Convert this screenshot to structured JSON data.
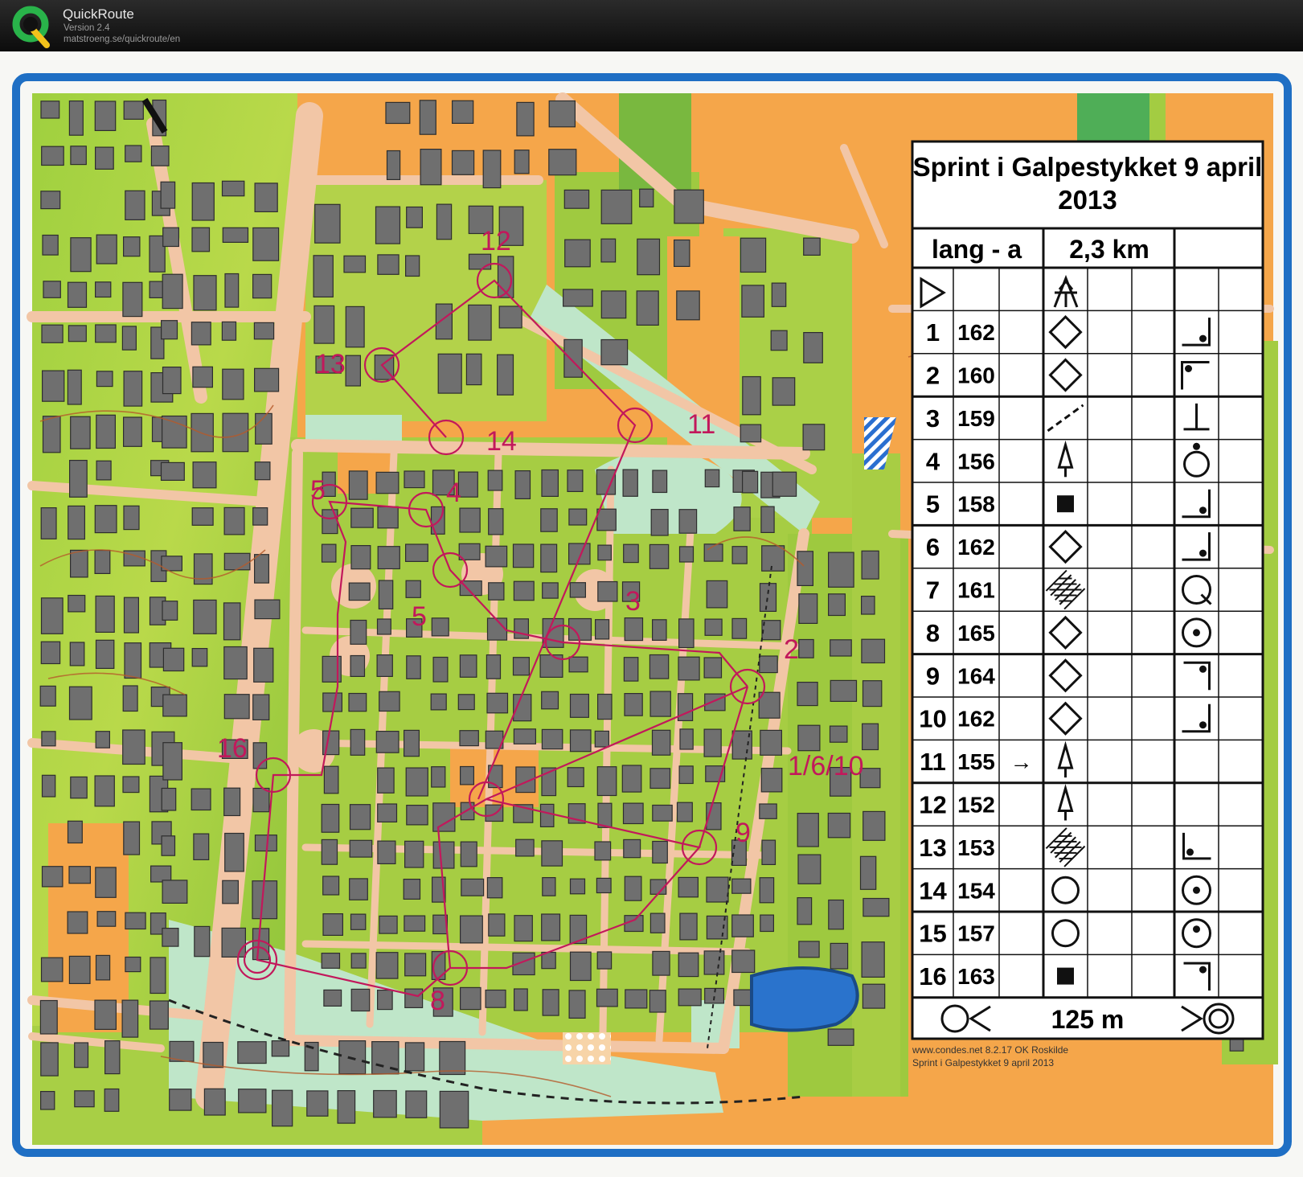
{
  "app": {
    "name": "QuickRoute",
    "version": "Version 2.4",
    "url": "matstroeng.se/quickroute/en"
  },
  "map": {
    "credit_line1": "www.condes.net 8.2.17 OK Roskilde",
    "credit_line2": "Sprint i Galpestykket 9 april 2013",
    "control_labels": [
      {
        "text": "11"
      },
      {
        "text": "12"
      },
      {
        "text": "13"
      },
      {
        "text": "14"
      },
      {
        "text": "5"
      },
      {
        "text": "4"
      },
      {
        "text": "5"
      },
      {
        "text": "3"
      },
      {
        "text": "2"
      },
      {
        "text": "1/6/10"
      },
      {
        "text": "16"
      },
      {
        "text": "9"
      },
      {
        "text": "8"
      }
    ],
    "colors": {
      "open_land": "#f7a84a",
      "green": "#9ccb3b",
      "building": "#6f6f6f",
      "paved": "#f2c6a6",
      "course": "#c2185b",
      "border": "#1f6fc4"
    }
  },
  "description": {
    "title_line1": "Sprint i Galpestykket 9 april",
    "title_line2": "2013",
    "class": "lang - a",
    "length": "2,3 km",
    "finish_distance": "125 m",
    "rows": [
      {
        "num": "1",
        "code": "162",
        "symbol": "diamond",
        "dir": "",
        "extra": "br"
      },
      {
        "num": "2",
        "code": "160",
        "symbol": "diamond",
        "dir": "",
        "extra": "tl"
      },
      {
        "num": "3",
        "code": "159",
        "symbol": "dash",
        "dir": "",
        "extra": "bt"
      },
      {
        "num": "4",
        "code": "156",
        "symbol": "tree",
        "dir": "",
        "extra": "oc"
      },
      {
        "num": "5",
        "code": "158",
        "symbol": "square",
        "dir": "",
        "extra": "br"
      },
      {
        "num": "6",
        "code": "162",
        "symbol": "diamond",
        "dir": "",
        "extra": "br"
      },
      {
        "num": "7",
        "code": "161",
        "symbol": "thicket",
        "dir": "",
        "extra": "oq"
      },
      {
        "num": "8",
        "code": "165",
        "symbol": "diamond",
        "dir": "",
        "extra": "od"
      },
      {
        "num": "9",
        "code": "164",
        "symbol": "diamond",
        "dir": "",
        "extra": "tr"
      },
      {
        "num": "10",
        "code": "162",
        "symbol": "diamond",
        "dir": "",
        "extra": "br"
      },
      {
        "num": "11",
        "code": "155",
        "symbol": "tree",
        "dir": "→",
        "extra": ""
      },
      {
        "num": "12",
        "code": "152",
        "symbol": "tree",
        "dir": "",
        "extra": ""
      },
      {
        "num": "13",
        "code": "153",
        "symbol": "thicket",
        "dir": "",
        "extra": "bl"
      },
      {
        "num": "14",
        "code": "154",
        "symbol": "circle",
        "dir": "",
        "extra": "od"
      },
      {
        "num": "15",
        "code": "157",
        "symbol": "circle",
        "dir": "",
        "extra": "od2"
      },
      {
        "num": "16",
        "code": "163",
        "symbol": "square",
        "dir": "",
        "extra": "tr2"
      }
    ]
  }
}
